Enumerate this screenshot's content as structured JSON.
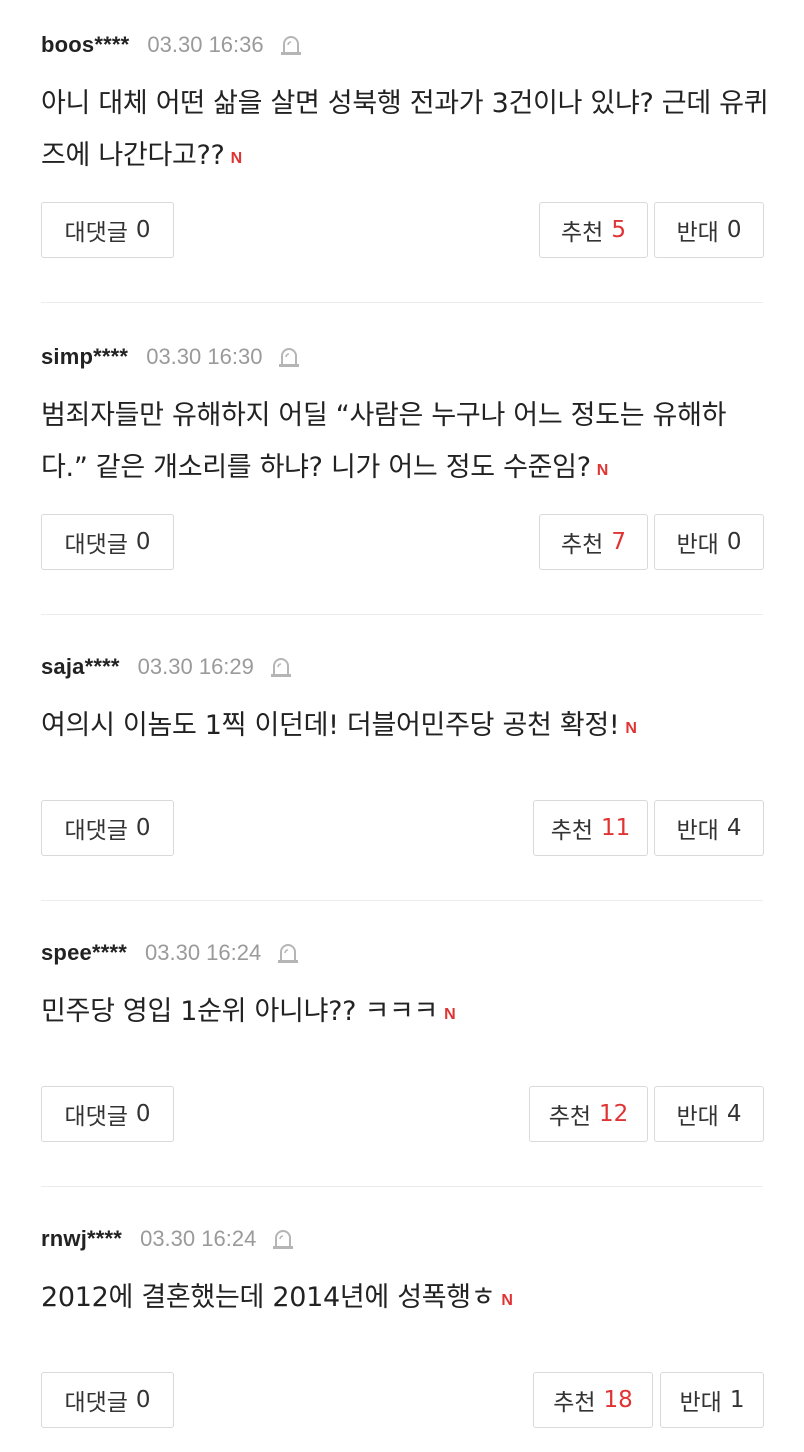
{
  "comments": [
    {
      "username": "boos****",
      "timestamp": "03.30 16:36",
      "text": "아니 대체 어떤 삶을 살면 성북행 전과가 3건이나 있냐? 근데 유퀴즈에 나간다고??",
      "badge": "N",
      "reply_label": "대댓글",
      "reply_count": "0",
      "like_label": "추천",
      "like_count": "5",
      "dislike_label": "반대",
      "dislike_count": "0"
    },
    {
      "username": "simp****",
      "timestamp": "03.30 16:30",
      "text": "범죄자들만 유해하지 어딜 “사람은 누구나 어느 정도는 유해하다.” 같은 개소리를 하냐? 니가 어느 정도 수준임?",
      "badge": "N",
      "reply_label": "대댓글",
      "reply_count": "0",
      "like_label": "추천",
      "like_count": "7",
      "dislike_label": "반대",
      "dislike_count": "0"
    },
    {
      "username": "saja****",
      "timestamp": "03.30 16:29",
      "text": "여의시 이놈도 1찍 이던데! 더블어민주당 공천 확정!",
      "badge": "N",
      "reply_label": "대댓글",
      "reply_count": "0",
      "like_label": "추천",
      "like_count": "11",
      "dislike_label": "반대",
      "dislike_count": "4"
    },
    {
      "username": "spee****",
      "timestamp": "03.30 16:24",
      "text": "민주당 영입 1순위 아니냐?? ㅋㅋㅋ",
      "badge": "N",
      "reply_label": "대댓글",
      "reply_count": "0",
      "like_label": "추천",
      "like_count": "12",
      "dislike_label": "반대",
      "dislike_count": "4"
    },
    {
      "username": "rnwj****",
      "timestamp": "03.30 16:24",
      "text": "2012에 결혼했는데 2014년에 성폭행ㅎ",
      "badge": "N",
      "reply_label": "대댓글",
      "reply_count": "0",
      "like_label": "추천",
      "like_count": "18",
      "dislike_label": "반대",
      "dislike_count": "1"
    }
  ],
  "icons": {
    "report": "report-siren-icon"
  },
  "colors": {
    "accent_red": "#e03333",
    "timestamp_gray": "#9a9a9a",
    "border_gray": "#d9d9d9"
  }
}
